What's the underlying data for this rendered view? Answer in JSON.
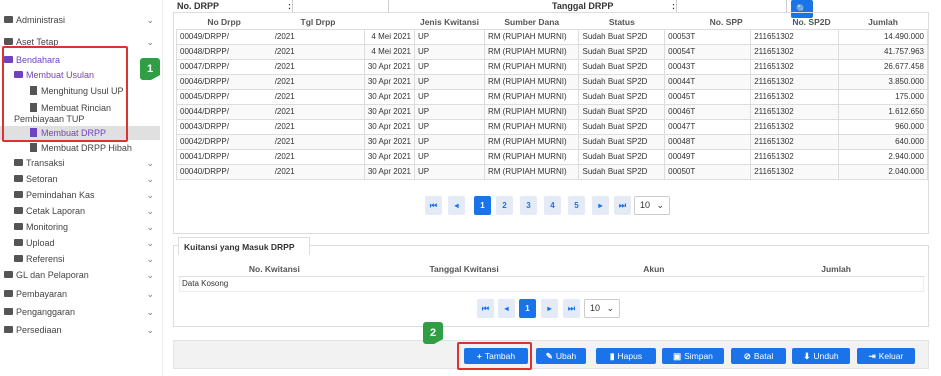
{
  "sidebar": {
    "items": [
      {
        "label": "Administrasi",
        "chev": "⌄"
      },
      {
        "label": "Aset Tetap",
        "chev": "⌄"
      },
      {
        "label": "Bendahara"
      },
      {
        "label": "Membuat Usulan"
      },
      {
        "label": "Menghitung Usul UP"
      },
      {
        "label": "Membuat Rincian"
      },
      {
        "label": "Pembiayaan TUP"
      },
      {
        "label": "Membuat DRPP"
      },
      {
        "label": "Membuat DRPP Hibah"
      },
      {
        "label": "Transaksi",
        "chev": "⌄"
      },
      {
        "label": "Setoran",
        "chev": "⌄"
      },
      {
        "label": "Pemindahan Kas",
        "chev": "⌄"
      },
      {
        "label": "Cetak Laporan",
        "chev": "⌄"
      },
      {
        "label": "Monitoring",
        "chev": "⌄"
      },
      {
        "label": "Upload",
        "chev": "⌄"
      },
      {
        "label": "Referensi",
        "chev": "⌄"
      },
      {
        "label": "GL dan Pelaporan",
        "chev": "⌄"
      },
      {
        "label": "Pembayaran",
        "chev": "⌄"
      },
      {
        "label": "Penganggaran",
        "chev": "⌄"
      },
      {
        "label": "Persediaan",
        "chev": "⌄"
      }
    ]
  },
  "badges": {
    "one": "1",
    "two": "2"
  },
  "filters": {
    "no_drpp_label": "No. DRPP",
    "tgl_drpp_label": "Tanggal DRPP",
    "colon": ":",
    "search_icon": "🔍"
  },
  "grid1": {
    "columns": [
      "No Drpp",
      "Tgl Drpp",
      "Jenis Kwitansi",
      "Sumber Dana",
      "Status",
      "No. SPP",
      "No. SP2D",
      "Jumlah"
    ],
    "rows": [
      [
        "00049/DRPP/",
        "/2021",
        "4 Mei 2021",
        "UP",
        "RM (RUPIAH MURNI)",
        "Sudah Buat SP2D",
        "00053T",
        "211651302",
        "14.490.000"
      ],
      [
        "00048/DRPP/",
        "/2021",
        "4 Mei 2021",
        "UP",
        "RM (RUPIAH MURNI)",
        "Sudah Buat SP2D",
        "00054T",
        "211651302",
        "41.757.963"
      ],
      [
        "00047/DRPP/",
        "/2021",
        "30 Apr 2021",
        "UP",
        "RM (RUPIAH MURNI)",
        "Sudah Buat SP2D",
        "00043T",
        "211651302",
        "26.677.458"
      ],
      [
        "00046/DRPP/",
        "/2021",
        "30 Apr 2021",
        "UP",
        "RM (RUPIAH MURNI)",
        "Sudah Buat SP2D",
        "00044T",
        "211651302",
        "3.850.000"
      ],
      [
        "00045/DRPP/",
        "/2021",
        "30 Apr 2021",
        "UP",
        "RM (RUPIAH MURNI)",
        "Sudah Buat SP2D",
        "00045T",
        "211651302",
        "175.000"
      ],
      [
        "00044/DRPP/",
        "/2021",
        "30 Apr 2021",
        "UP",
        "RM (RUPIAH MURNI)",
        "Sudah Buat SP2D",
        "00046T",
        "211651302",
        "1.612.650"
      ],
      [
        "00043/DRPP/",
        "/2021",
        "30 Apr 2021",
        "UP",
        "RM (RUPIAH MURNI)",
        "Sudah Buat SP2D",
        "00047T",
        "211651302",
        "960.000"
      ],
      [
        "00042/DRPP/",
        "/2021",
        "30 Apr 2021",
        "UP",
        "RM (RUPIAH MURNI)",
        "Sudah Buat SP2D",
        "00048T",
        "211651302",
        "640.000"
      ],
      [
        "00041/DRPP/",
        "/2021",
        "30 Apr 2021",
        "UP",
        "RM (RUPIAH MURNI)",
        "Sudah Buat SP2D",
        "00049T",
        "211651302",
        "2.940.000"
      ],
      [
        "00040/DRPP/",
        "/2021",
        "30 Apr 2021",
        "UP",
        "RM (RUPIAH MURNI)",
        "Sudah Buat SP2D",
        "00050T",
        "211651302",
        "2.040.000"
      ]
    ]
  },
  "pager1": {
    "first": "⏮",
    "prev": "◂",
    "pages": [
      "1",
      "2",
      "3",
      "4",
      "5"
    ],
    "next": "▸",
    "last": "⏭",
    "size": "10"
  },
  "panel2": {
    "tab": "Kuitansi yang Masuk DRPP",
    "columns": [
      "No. Kwitansi",
      "Tanggal Kwitansi",
      "Akun",
      "Jumlah"
    ],
    "empty": "Data Kosong"
  },
  "pager2": {
    "first": "⏮",
    "prev": "◂",
    "pages": [
      "1"
    ],
    "next": "▸",
    "last": "⏭",
    "size": "10"
  },
  "buttons": [
    {
      "icon": "+",
      "label": "Tambah"
    },
    {
      "icon": "✎",
      "label": "Ubah"
    },
    {
      "icon": "▮",
      "label": "Hapus"
    },
    {
      "icon": "▣",
      "label": "Simpan"
    },
    {
      "icon": "⊘",
      "label": "Batal"
    },
    {
      "icon": "⬇",
      "label": "Unduh"
    },
    {
      "icon": "⇥",
      "label": "Keluar"
    }
  ],
  "colors": {
    "primary": "#1a73e8",
    "purple": "#6f42c1",
    "highlight": "#e03131",
    "badge": "#2f9e44"
  }
}
